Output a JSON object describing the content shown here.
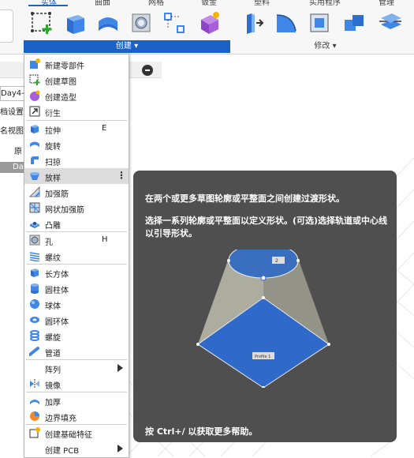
{
  "ribbon": {
    "tabs": [
      "实体",
      "曲面",
      "网格",
      "钣金",
      "塑料",
      "实用程序",
      "管理"
    ],
    "active_tab": "实体",
    "groups": {
      "create_label": "创建 ▾",
      "modify_label": "修改 ▾"
    },
    "accent": "#1a62c6"
  },
  "browser_panel": {
    "doc_tab": "Day4-",
    "row_settings": "档设置",
    "row_named_views": "名视图",
    "row_origin": "原",
    "row_selected": "Da"
  },
  "create_menu": {
    "items": [
      {
        "label": "新建零部件",
        "shortcut": "",
        "icon": "new-component-icon"
      },
      {
        "label": "创建草图",
        "shortcut": "",
        "icon": "sketch-icon"
      },
      {
        "label": "创建造型",
        "shortcut": "",
        "icon": "form-icon"
      },
      {
        "label": "衍生",
        "shortcut": "",
        "icon": "derive-icon"
      },
      {
        "label": "拉伸",
        "shortcut": "E",
        "icon": "extrude-icon"
      },
      {
        "label": "旋转",
        "shortcut": "",
        "icon": "revolve-icon"
      },
      {
        "label": "扫掠",
        "shortcut": "",
        "icon": "sweep-icon"
      },
      {
        "label": "放样",
        "shortcut": "",
        "icon": "loft-icon",
        "more": "⋮"
      },
      {
        "label": "加强筋",
        "shortcut": "",
        "icon": "rib-icon"
      },
      {
        "label": "网状加强筋",
        "shortcut": "",
        "icon": "web-icon"
      },
      {
        "label": "凸雕",
        "shortcut": "",
        "icon": "emboss-icon"
      },
      {
        "label": "孔",
        "shortcut": "H",
        "icon": "hole-icon"
      },
      {
        "label": "螺纹",
        "shortcut": "",
        "icon": "thread-icon"
      },
      {
        "label": "长方体",
        "shortcut": "",
        "icon": "box-icon"
      },
      {
        "label": "圆柱体",
        "shortcut": "",
        "icon": "cylinder-icon"
      },
      {
        "label": "球体",
        "shortcut": "",
        "icon": "sphere-icon"
      },
      {
        "label": "圆环体",
        "shortcut": "",
        "icon": "torus-icon"
      },
      {
        "label": "螺旋",
        "shortcut": "",
        "icon": "coil-icon"
      },
      {
        "label": "管道",
        "shortcut": "",
        "icon": "pipe-icon"
      },
      {
        "label": "阵列",
        "shortcut": "",
        "icon": "pattern-icon"
      },
      {
        "label": "镜像",
        "shortcut": "",
        "icon": "mirror-icon"
      },
      {
        "label": "加厚",
        "shortcut": "",
        "icon": "thicken-icon"
      },
      {
        "label": "边界填充",
        "shortcut": "",
        "icon": "boundary-fill-icon"
      },
      {
        "label": "创建基础特征",
        "shortcut": "",
        "icon": "base-feature-icon"
      },
      {
        "label": "创建 PCB",
        "shortcut": "",
        "icon": "pcb-icon"
      }
    ]
  },
  "tooltip": {
    "line1": "在两个或更多草图轮廓或平整面之间创建过渡形状。",
    "line2": "选择一系列轮廓或平整面以定义形状。(可选)选择轨道或中心线以引导形状。",
    "profile_top_label": "2",
    "profile_bottom_label": "Profile 1",
    "help": "按 Ctrl+/ 以获取更多帮助。"
  }
}
